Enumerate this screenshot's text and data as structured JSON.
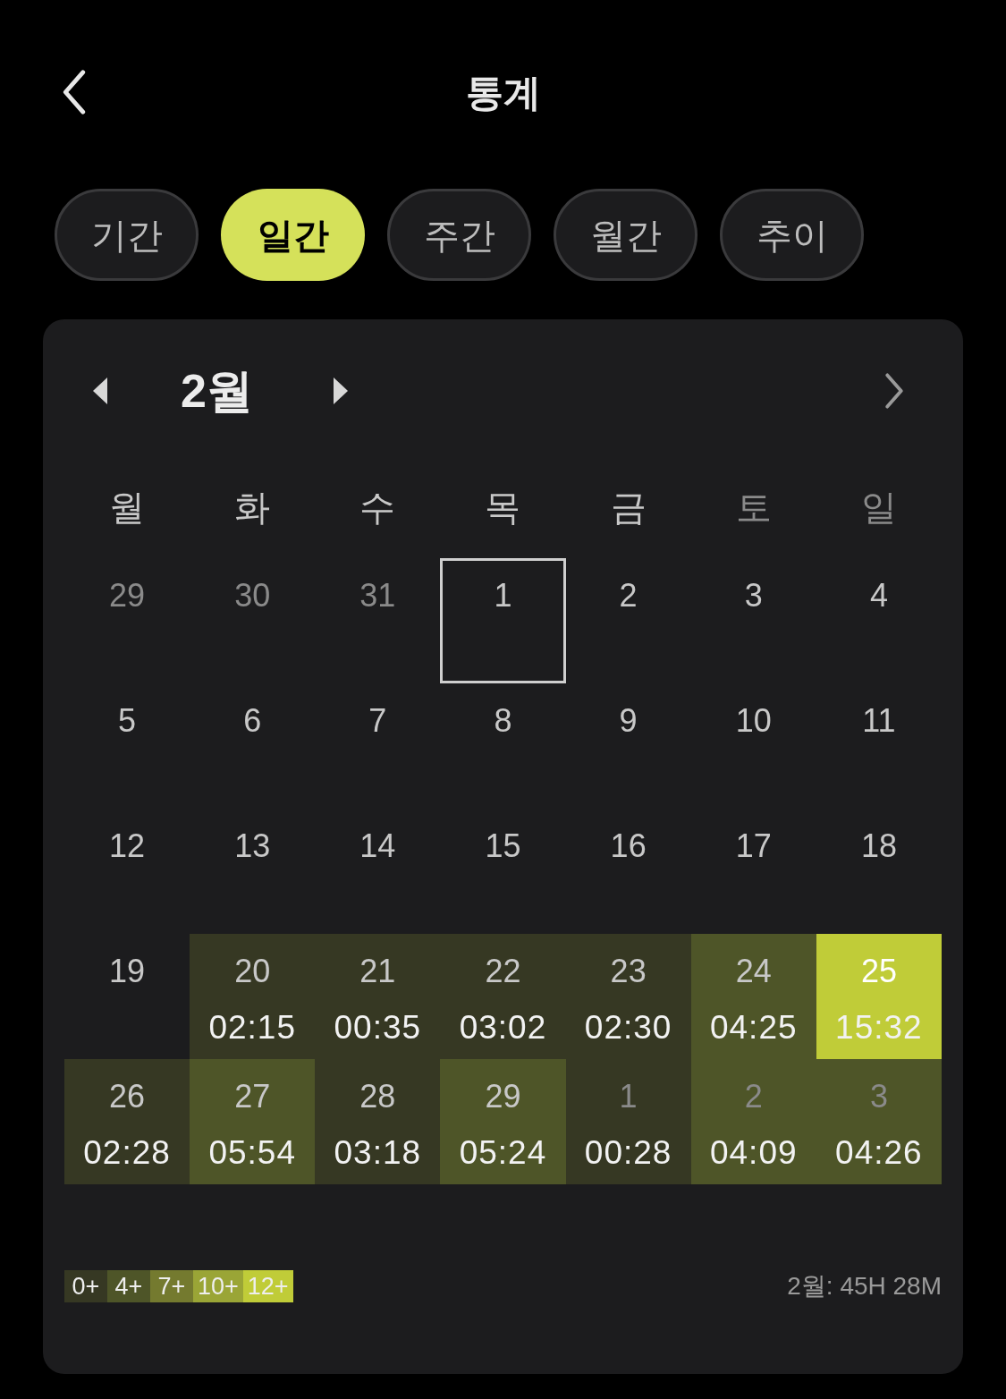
{
  "header": {
    "title": "통계"
  },
  "tabs": [
    {
      "label": "기간",
      "selected": false
    },
    {
      "label": "일간",
      "selected": true
    },
    {
      "label": "주간",
      "selected": false
    },
    {
      "label": "월간",
      "selected": false
    },
    {
      "label": "추이",
      "selected": false
    }
  ],
  "calendar": {
    "month": "2월",
    "weekdays": [
      {
        "label": "월",
        "weekend": false
      },
      {
        "label": "화",
        "weekend": false
      },
      {
        "label": "수",
        "weekend": false
      },
      {
        "label": "목",
        "weekend": false
      },
      {
        "label": "금",
        "weekend": false
      },
      {
        "label": "토",
        "weekend": true
      },
      {
        "label": "일",
        "weekend": true
      }
    ],
    "days": [
      {
        "day": "29",
        "other_month": true,
        "today": false
      },
      {
        "day": "30",
        "other_month": true,
        "today": false
      },
      {
        "day": "31",
        "other_month": true,
        "today": false
      },
      {
        "day": "1",
        "other_month": false,
        "today": true
      },
      {
        "day": "2",
        "other_month": false,
        "today": false
      },
      {
        "day": "3",
        "other_month": false,
        "today": false
      },
      {
        "day": "4",
        "other_month": false,
        "today": false
      },
      {
        "day": "5",
        "other_month": false,
        "today": false
      },
      {
        "day": "6",
        "other_month": false,
        "today": false
      },
      {
        "day": "7",
        "other_month": false,
        "today": false
      },
      {
        "day": "8",
        "other_month": false,
        "today": false
      },
      {
        "day": "9",
        "other_month": false,
        "today": false
      },
      {
        "day": "10",
        "other_month": false,
        "today": false
      },
      {
        "day": "11",
        "other_month": false,
        "today": false
      },
      {
        "day": "12",
        "other_month": false,
        "today": false
      },
      {
        "day": "13",
        "other_month": false,
        "today": false
      },
      {
        "day": "14",
        "other_month": false,
        "today": false
      },
      {
        "day": "15",
        "other_month": false,
        "today": false
      },
      {
        "day": "16",
        "other_month": false,
        "today": false
      },
      {
        "day": "17",
        "other_month": false,
        "today": false
      },
      {
        "day": "18",
        "other_month": false,
        "today": false
      },
      {
        "day": "19",
        "other_month": false,
        "today": false
      },
      {
        "day": "20",
        "time": "02:15",
        "color": "#363823",
        "other_month": false,
        "today": false
      },
      {
        "day": "21",
        "time": "00:35",
        "color": "#363823",
        "other_month": false,
        "today": false
      },
      {
        "day": "22",
        "time": "03:02",
        "color": "#363823",
        "other_month": false,
        "today": false
      },
      {
        "day": "23",
        "time": "02:30",
        "color": "#363823",
        "other_month": false,
        "today": false
      },
      {
        "day": "24",
        "time": "04:25",
        "color": "#4e5528",
        "other_month": false,
        "today": false
      },
      {
        "day": "25",
        "time": "15:32",
        "color": "#c0cc38",
        "other_month": false,
        "today": false
      },
      {
        "day": "26",
        "time": "02:28",
        "color": "#363823",
        "other_month": false,
        "today": false
      },
      {
        "day": "27",
        "time": "05:54",
        "color": "#4e5528",
        "other_month": false,
        "today": false
      },
      {
        "day": "28",
        "time": "03:18",
        "color": "#363823",
        "other_month": false,
        "today": false
      },
      {
        "day": "29",
        "time": "05:24",
        "color": "#4e5528",
        "other_month": false,
        "today": false
      },
      {
        "day": "1",
        "time": "00:28",
        "color": "#363823",
        "other_month": true,
        "today": false
      },
      {
        "day": "2",
        "time": "04:09",
        "color": "#4e5528",
        "other_month": true,
        "today": false
      },
      {
        "day": "3",
        "time": "04:26",
        "color": "#4e5528",
        "other_month": true,
        "today": false
      }
    ]
  },
  "legend": [
    {
      "label": "0+",
      "color": "#363823"
    },
    {
      "label": "4+",
      "color": "#4e5528"
    },
    {
      "label": "7+",
      "color": "#747a2f"
    },
    {
      "label": "10+",
      "color": "#9aa536"
    },
    {
      "label": "12+",
      "color": "#c0cc38"
    }
  ],
  "total": "2월: 45H 28M"
}
